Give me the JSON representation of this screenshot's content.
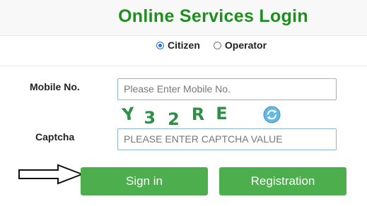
{
  "header": {
    "title": "Online Services Login"
  },
  "user_type": {
    "options": [
      {
        "label": "Citizen",
        "selected": true
      },
      {
        "label": "Operator",
        "selected": false
      }
    ]
  },
  "form": {
    "mobile_label": "Mobile No.",
    "mobile_placeholder": "Please Enter Mobile No.",
    "captcha_label": "Captcha",
    "captcha_placeholder": "PLEASE ENTER CAPTCHA VALUE",
    "captcha_chars": [
      "Y",
      "3",
      "2",
      "R",
      "E"
    ]
  },
  "buttons": {
    "sign_in": "Sign in",
    "registration": "Registration"
  },
  "colors": {
    "accent_green": "#4cae4c",
    "title_green": "#1e8e1e",
    "input_border": "#8fb8d6",
    "radio_blue": "#1a73e8"
  },
  "icons": {
    "refresh": "refresh-icon",
    "pointer_arrow": "arrow-right-icon"
  }
}
